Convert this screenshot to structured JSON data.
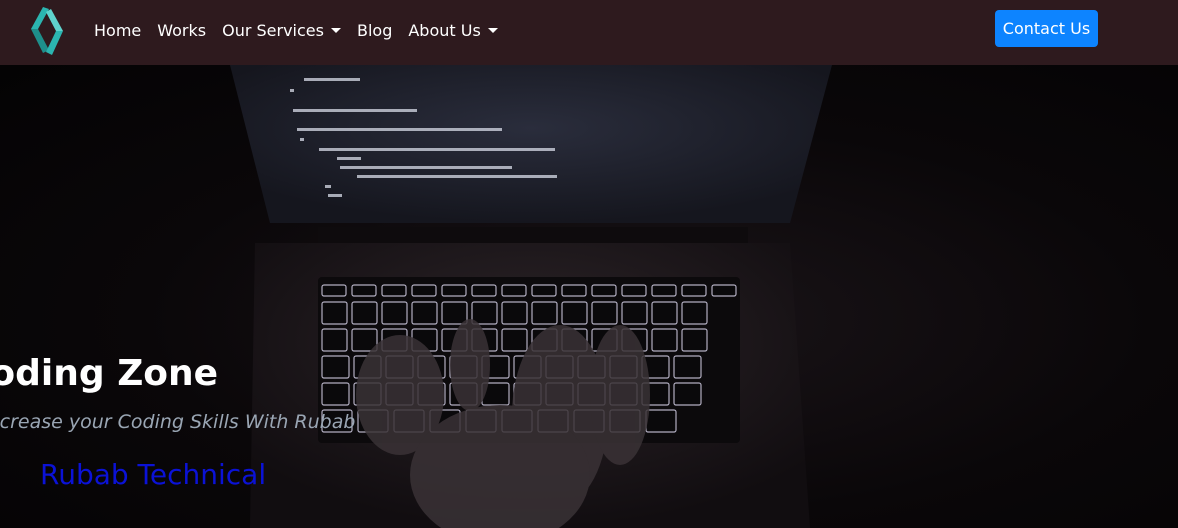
{
  "navbar": {
    "logo_icon": "chevron-logo-icon",
    "links": [
      {
        "label": "Home",
        "dropdown": false
      },
      {
        "label": "Works",
        "dropdown": false
      },
      {
        "label": "Our Services",
        "dropdown": true
      },
      {
        "label": "Blog",
        "dropdown": false
      },
      {
        "label": "About Us",
        "dropdown": true
      }
    ],
    "contact_label": "Contact Us"
  },
  "hero": {
    "title": "Coding Zone",
    "subtitle": "Increase your Coding Skills With Rubab",
    "brand": "Rubab Technical"
  },
  "colors": {
    "navbar_bg": "#2e1a1e",
    "contact_button": "#0d84ff",
    "brand_text": "#0b12d6",
    "subtitle_text": "#9aa6b4",
    "logo_teal": "#2bb5b0"
  }
}
